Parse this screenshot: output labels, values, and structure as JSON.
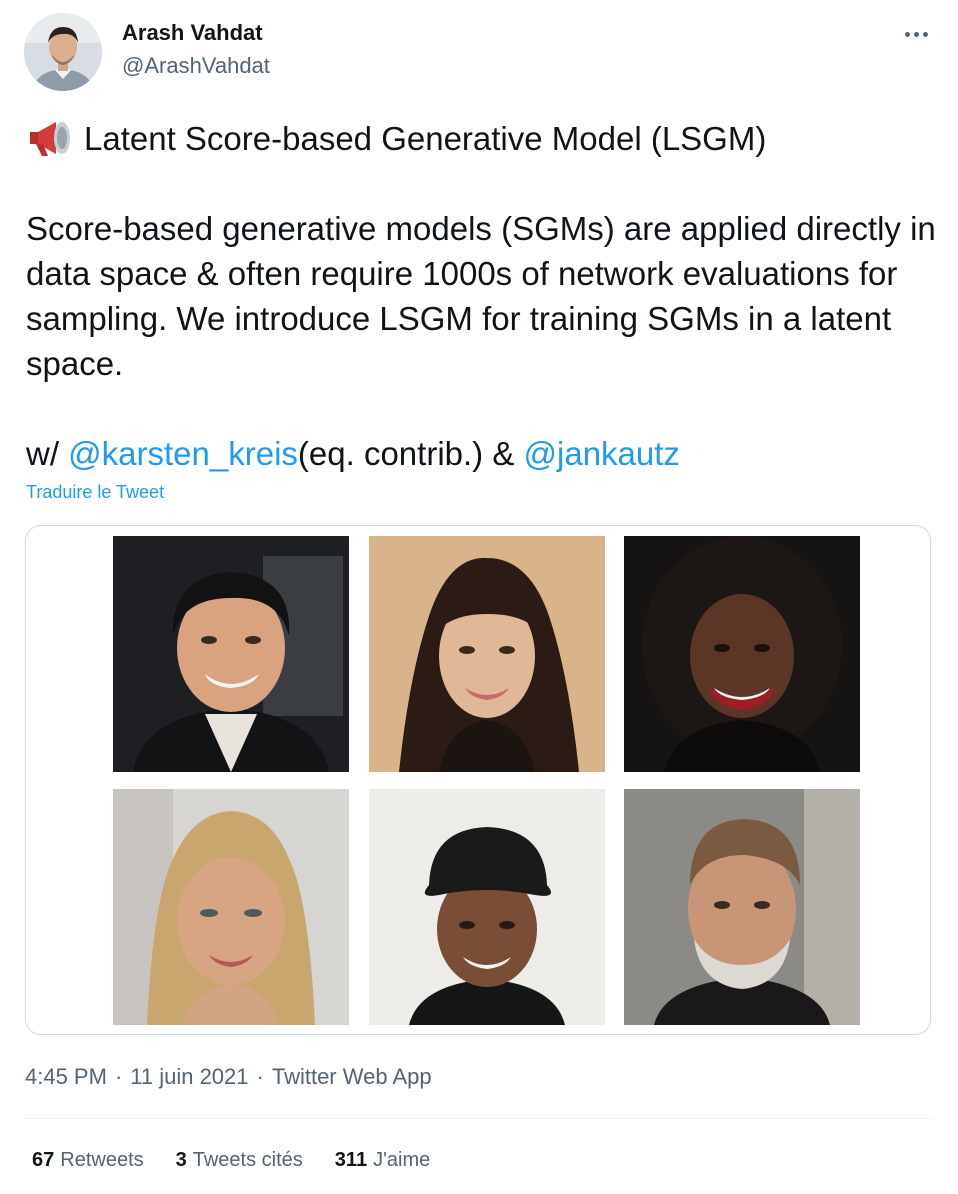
{
  "author": {
    "name": "Arash Vahdat",
    "handle": "@ArashVahdat"
  },
  "tweet": {
    "title_line": "Latent Score-based Generative Model (LSGM)",
    "paragraph": "Score-based generative models (SGMs) are applied directly in data space & often require 1000s of network evaluations for sampling. We introduce LSGM for training SGMs in a latent space.",
    "credit_prefix": "w/ ",
    "mention_1": "@karsten_kreis",
    "credit_middle": "(eq. contrib.) & ",
    "mention_2": "@jankautz",
    "emoji_icon": "megaphone-icon"
  },
  "translate_label": "Traduire le Tweet",
  "meta": {
    "time": "4:45 PM",
    "separator": "·",
    "date": "11 juin 2021",
    "source": "Twitter Web App"
  },
  "stats": {
    "retweets_count": "67",
    "retweets_label": "Retweets",
    "quotes_count": "3",
    "quotes_label": "Tweets cités",
    "likes_count": "311",
    "likes_label": "J'aime"
  },
  "colors": {
    "text": "#0f1419",
    "secondary": "#536471",
    "link": "#1d9bf0",
    "border": "#cfd9de"
  }
}
